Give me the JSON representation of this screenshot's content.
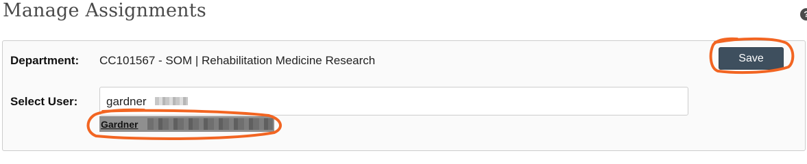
{
  "page": {
    "title": "Manage Assignments",
    "help_icon": "question-circle-icon"
  },
  "department": {
    "label": "Department:",
    "value": "CC101567 - SOM | Rehabilitation Medicine Research"
  },
  "toolbar": {
    "save_label": "Save"
  },
  "select_user": {
    "label": "Select User:",
    "input_value": "gardner"
  },
  "autocomplete": {
    "suggestion_name": "Gardner"
  },
  "colors": {
    "save_button_bg": "#3e4f5e",
    "annotation": "#f26522",
    "suggestion_bg": "#8f8f8f"
  }
}
